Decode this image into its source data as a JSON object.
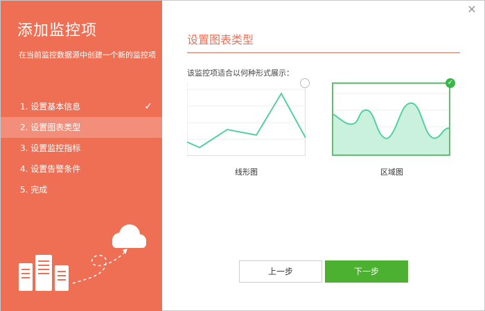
{
  "sidebar": {
    "title": "添加监控项",
    "description": "在当前监控数据源中创建一个新的监控项",
    "steps": [
      {
        "label": "1. 设置基本信息",
        "state": "done"
      },
      {
        "label": "2. 设置图表类型",
        "state": "active"
      },
      {
        "label": "3. 设置监控指标",
        "state": "pending"
      },
      {
        "label": "4. 设置告警条件",
        "state": "pending"
      },
      {
        "label": "5. 完成",
        "state": "pending"
      }
    ],
    "check_glyph": "✓",
    "colors": {
      "background": "#ef6f55",
      "active_row": "rgba(255,255,255,0.22)"
    }
  },
  "dialog": {
    "close_glyph": "✕"
  },
  "content": {
    "title": "设置图表类型",
    "question": "该监控项适合以何种形式展示：",
    "options": [
      {
        "label": "线形图",
        "type": "line",
        "selected": false
      },
      {
        "label": "区域图",
        "type": "area",
        "selected": true
      }
    ],
    "selected_glyph": "✓"
  },
  "buttons": {
    "prev_label": "上一步",
    "next_label": "下一步"
  },
  "colors": {
    "accent": "#ef6f55",
    "success": "#4cb130",
    "chart_line": "#52d0a0",
    "chart_area_fill": "#c9f1de"
  }
}
